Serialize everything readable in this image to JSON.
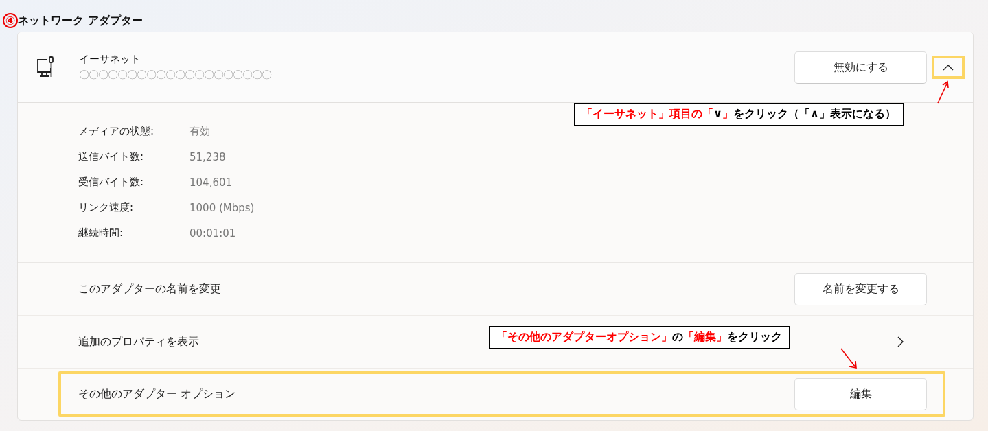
{
  "section_title": {
    "number": "④",
    "text": "ネットワーク アダプター"
  },
  "adapter": {
    "name": "イーサネット",
    "description": "〇〇〇〇〇〇〇〇〇〇〇〇〇〇〇〇〇〇〇〇",
    "disable_button": "無効にする",
    "expanded": true,
    "expand_highlighted": true
  },
  "details": [
    {
      "label": "メディアの状態:",
      "value": "有効"
    },
    {
      "label": "送信バイト数:",
      "value": "51,238"
    },
    {
      "label": "受信バイト数:",
      "value": "104,601"
    },
    {
      "label": "リンク速度:",
      "value": "1000 (Mbps)"
    },
    {
      "label": "継続時間:",
      "value": "00:01:01"
    }
  ],
  "rows": [
    {
      "kind": "button",
      "label": "このアダプターの名前を変更",
      "button": "名前を変更する",
      "highlighted": false
    },
    {
      "kind": "link",
      "label": "追加のプロパティを表示",
      "highlighted": false
    },
    {
      "kind": "button",
      "label": "その他のアダプター オプション",
      "button": "編集",
      "highlighted": true
    }
  ],
  "callouts": [
    {
      "segments": [
        {
          "text": "「イーサネット」項目の「",
          "emphasis": true
        },
        {
          "text": "∨",
          "emphasis": false
        },
        {
          "text": "」",
          "emphasis": true
        },
        {
          "text": "をクリック（「∧」表示になる）",
          "emphasis": false
        }
      ]
    },
    {
      "segments": [
        {
          "text": "「その他のアダプターオプション」",
          "emphasis": true
        },
        {
          "text": "の",
          "emphasis": false
        },
        {
          "text": "「編集」",
          "emphasis": true
        },
        {
          "text": "をクリック",
          "emphasis": false
        }
      ]
    }
  ]
}
